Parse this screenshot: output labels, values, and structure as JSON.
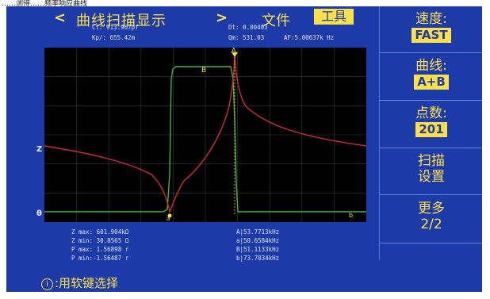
{
  "caption": "……测得……频率响应曲线",
  "header": {
    "back_arrow": "<",
    "title": "曲线扫描显示",
    "forward_arrow": ">",
    "menu_file": "文件",
    "menu_tools": "工具"
  },
  "readouts": {
    "ct": "Ct: 913.967pf",
    "dt": "Dt: 0.00403",
    "kp": "Kp/: 655.42m",
    "qm": "Qm: 531.03",
    "af": "AF:5.00637k Hz"
  },
  "softkeys": [
    {
      "title": "速度:",
      "value": "FAST"
    },
    {
      "title": "曲线:",
      "value": "A+B"
    },
    {
      "title": "点数:",
      "value": "201"
    },
    {
      "line1": "扫描",
      "line2": "设置"
    },
    {
      "line1": "更多",
      "line2": "2/2"
    }
  ],
  "chart_data": {
    "type": "line",
    "series": [
      {
        "name": "A",
        "color": "#c83228"
      },
      {
        "name": "B",
        "color": "#3fb04a"
      }
    ],
    "markers": [
      "A",
      "B",
      "a",
      "b"
    ],
    "axis_labels": [
      "Z",
      "θ"
    ],
    "grid": true
  },
  "stats_left": [
    "Z max: 601.904kΩ",
    "Z min: 30.8565 Ω",
    "P max: 1.56898 r",
    "P min:-1.56487 r"
  ],
  "stats_right": [
    "A|53.7713kHz",
    "a|50.6584kHz",
    "B|51.1133kHz",
    "b|73.7034kHz"
  ],
  "hint": {
    "icon": "i",
    "text": ":用软键选择"
  },
  "colors": {
    "screen": "#1c3aa8",
    "accent": "#ffe04a",
    "plot_bg": "#000000",
    "grid": "#3a3a3a"
  }
}
